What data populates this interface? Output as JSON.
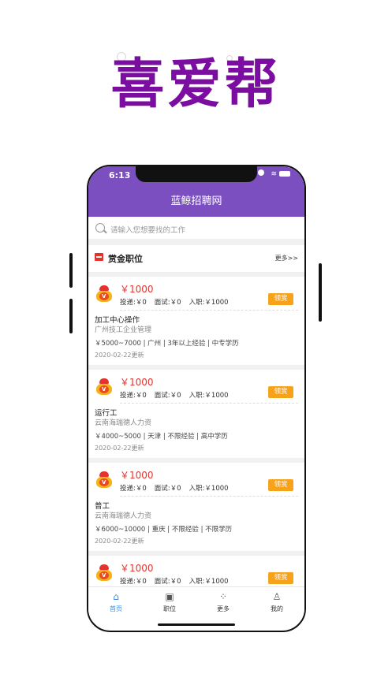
{
  "promo": {
    "headline": "喜爱帮"
  },
  "status_bar": {
    "time": "6:13"
  },
  "nav": {
    "title": "蓝鲸招聘网"
  },
  "search": {
    "placeholder": "请输入您想要找的工作"
  },
  "section": {
    "title": "赏金职位",
    "more": "更多>>"
  },
  "jobs": [
    {
      "reward": "￥1000",
      "speed": "投递:￥0",
      "interview": "面试:￥0",
      "onboard": "入职:￥1000",
      "claim": "领赏",
      "title": "加工中心操作",
      "company": "广州技工企业管理",
      "salary": "￥5000~7000",
      "city": "广州",
      "experience": "3年以上经验",
      "education": "中专学历",
      "date": "2020-02-22更新"
    },
    {
      "reward": "￥1000",
      "speed": "投递:￥0",
      "interview": "面试:￥0",
      "onboard": "入职:￥1000",
      "claim": "领赏",
      "title": "运行工",
      "company": "云南海瑞德人力资",
      "salary": "￥4000~5000",
      "city": "天津",
      "experience": "不限经验",
      "education": "高中学历",
      "date": "2020-02-22更新"
    },
    {
      "reward": "￥1000",
      "speed": "投递:￥0",
      "interview": "面试:￥0",
      "onboard": "入职:￥1000",
      "claim": "领赏",
      "title": "普工",
      "company": "云南海瑞德人力资",
      "salary": "￥6000~10000",
      "city": "重庆",
      "experience": "不限经验",
      "education": "不限学历",
      "date": "2020-02-22更新"
    },
    {
      "reward": "￥1000",
      "speed": "投递:￥0",
      "interview": "面试:￥0",
      "onboard": "入职:￥1000",
      "claim": "领赏"
    }
  ],
  "tabs": [
    {
      "label": "首页",
      "icon": "home-icon"
    },
    {
      "label": "职位",
      "icon": "briefcase-icon"
    },
    {
      "label": "更多",
      "icon": "grid-icon"
    },
    {
      "label": "我的",
      "icon": "user-icon"
    }
  ],
  "colors": {
    "brand_purple": "#7b4fc0",
    "headline_purple": "#7b0ea0",
    "reward_red": "#e5322d",
    "claim_orange": "#f7a21b",
    "tab_active": "#3a8ee6"
  }
}
